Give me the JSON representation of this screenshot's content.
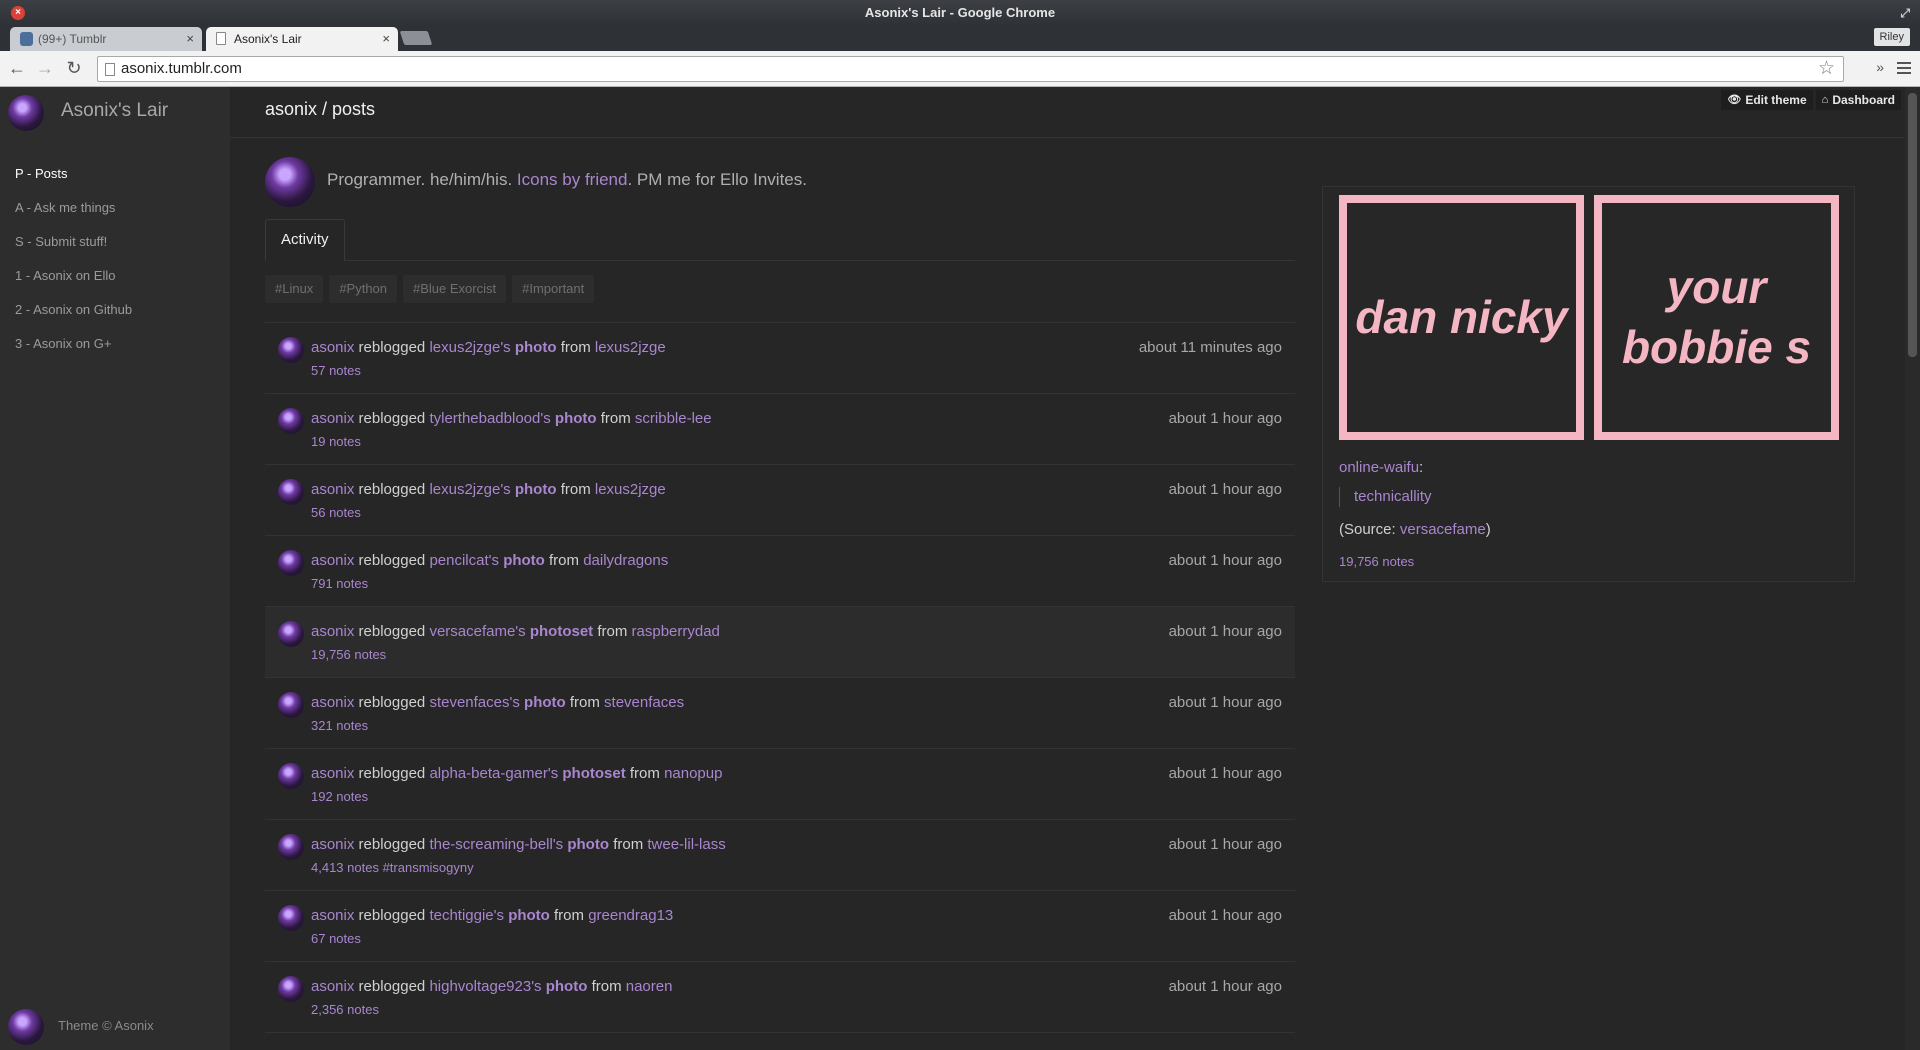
{
  "window": {
    "title": "Asonix's Lair - Google Chrome"
  },
  "browser": {
    "tabs": [
      {
        "label": "(99+) Tumblr"
      },
      {
        "label": "Asonix's Lair"
      }
    ],
    "profile": "Riley",
    "url": "asonix.tumblr.com"
  },
  "sidebar": {
    "title": "Asonix's Lair",
    "items": [
      {
        "label": "P - Posts"
      },
      {
        "label": "A - Ask me things"
      },
      {
        "label": "S - Submit stuff!"
      },
      {
        "label": "1 - Asonix on Ello"
      },
      {
        "label": "2 - Asonix on Github"
      },
      {
        "label": "3 - Asonix on G+"
      }
    ],
    "footer": "Theme © Asonix"
  },
  "header": {
    "breadcrumb": "asonix / posts",
    "edit_theme": "Edit theme",
    "dashboard": "Dashboard"
  },
  "bio": {
    "text_before": "Programmer. he/him/his. ",
    "link": "Icons by friend",
    "text_after": ". PM me for Ello Invites."
  },
  "tabs": {
    "activity": "Activity"
  },
  "tags": [
    "#Linux",
    "#Python",
    "#Blue Exorcist",
    "#Important"
  ],
  "activity": [
    {
      "user": "asonix",
      "verb": "reblogged",
      "owner": "lexus2jzge's",
      "type": "photo",
      "from": "from",
      "source": "lexus2jzge",
      "notes": "57 notes",
      "extra": "",
      "time": "about 11 minutes ago"
    },
    {
      "user": "asonix",
      "verb": "reblogged",
      "owner": "tylerthebadblood's",
      "type": "photo",
      "from": "from",
      "source": "scribble-lee",
      "notes": "19 notes",
      "extra": "",
      "time": "about 1 hour ago"
    },
    {
      "user": "asonix",
      "verb": "reblogged",
      "owner": "lexus2jzge's",
      "type": "photo",
      "from": "from",
      "source": "lexus2jzge",
      "notes": "56 notes",
      "extra": "",
      "time": "about 1 hour ago"
    },
    {
      "user": "asonix",
      "verb": "reblogged",
      "owner": "pencilcat's",
      "type": "photo",
      "from": "from",
      "source": "dailydragons",
      "notes": "791 notes",
      "extra": "",
      "time": "about 1 hour ago"
    },
    {
      "user": "asonix",
      "verb": "reblogged",
      "owner": "versacefame's",
      "type": "photoset",
      "from": "from",
      "source": "raspberrydad",
      "notes": "19,756 notes",
      "extra": "",
      "time": "about 1 hour ago"
    },
    {
      "user": "asonix",
      "verb": "reblogged",
      "owner": "stevenfaces's",
      "type": "photo",
      "from": "from",
      "source": "stevenfaces",
      "notes": "321 notes",
      "extra": "",
      "time": "about 1 hour ago"
    },
    {
      "user": "asonix",
      "verb": "reblogged",
      "owner": "alpha-beta-gamer's",
      "type": "photoset",
      "from": "from",
      "source": "nanopup",
      "notes": "192 notes",
      "extra": "",
      "time": "about 1 hour ago"
    },
    {
      "user": "asonix",
      "verb": "reblogged",
      "owner": "the-screaming-bell's",
      "type": "photo",
      "from": "from",
      "source": "twee-lil-lass",
      "notes": "4,413 notes",
      "extra": "#transmisogyny",
      "time": "about 1 hour ago"
    },
    {
      "user": "asonix",
      "verb": "reblogged",
      "owner": "techtiggie's",
      "type": "photo",
      "from": "from",
      "source": "greendrag13",
      "notes": "67 notes",
      "extra": "",
      "time": "about 1 hour ago"
    },
    {
      "user": "asonix",
      "verb": "reblogged",
      "owner": "highvoltage923's",
      "type": "photo",
      "from": "from",
      "source": "naoren",
      "notes": "2,356 notes",
      "extra": "",
      "time": "about 1 hour ago"
    }
  ],
  "post_preview": {
    "images": [
      {
        "text": "dan nicky"
      },
      {
        "text": "your bobbie s"
      }
    ],
    "author": "online-waifu",
    "author_suffix": ":",
    "quote": "technicallity",
    "source_prefix": "(Source: ",
    "source_link": "versacefame",
    "source_suffix": ")",
    "notes": "19,756 notes",
    "accent_pink": "#f4b6c2"
  },
  "colors": {
    "link": "#a986cf",
    "background": "#262626",
    "sidebar": "#2d2d2d"
  }
}
